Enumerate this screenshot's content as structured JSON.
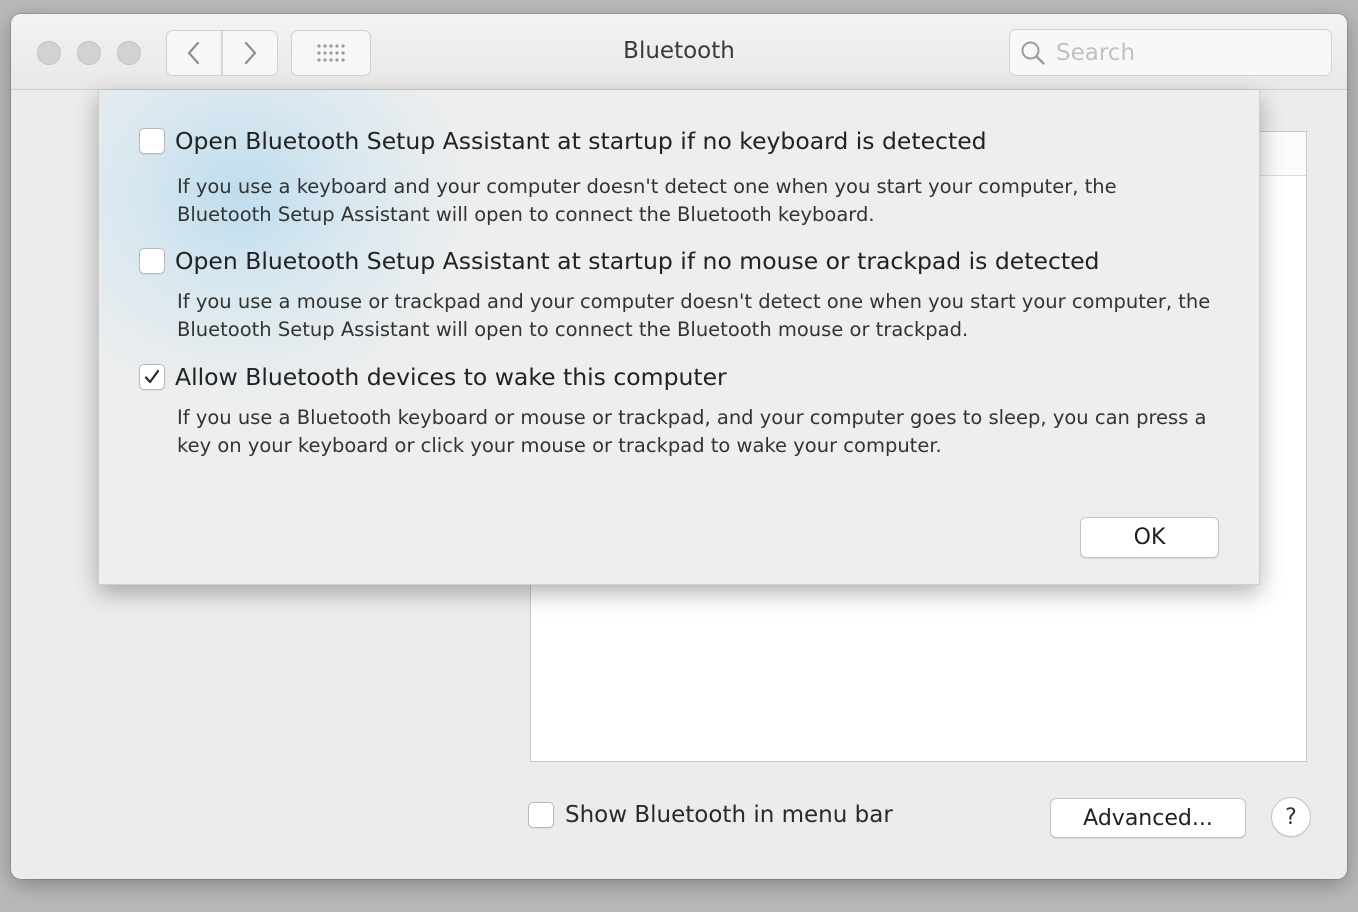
{
  "window": {
    "title": "Bluetooth",
    "search_placeholder": "Search"
  },
  "sheet": {
    "options": [
      {
        "label": "Open Bluetooth Setup Assistant at startup if no keyboard is detected",
        "checked": false,
        "description": "If you use a keyboard and your computer doesn't detect one when you start your computer, the Bluetooth Setup Assistant will open to connect the Bluetooth keyboard."
      },
      {
        "label": "Open Bluetooth Setup Assistant at startup if no mouse or trackpad is detected",
        "checked": false,
        "description": "If you use a mouse or trackpad and your computer doesn't detect one when you start your computer, the Bluetooth Setup Assistant will open to connect the Bluetooth mouse or trackpad."
      },
      {
        "label": "Allow Bluetooth devices to wake this computer",
        "checked": true,
        "description": "If you use a Bluetooth keyboard or mouse or trackpad, and your computer goes to sleep, you can press a key on your keyboard or click your mouse or trackpad to wake your computer."
      }
    ],
    "ok_label": "OK"
  },
  "footer": {
    "show_in_menu_bar_label": "Show Bluetooth in menu bar",
    "show_in_menu_bar_checked": false,
    "advanced_label": "Advanced...",
    "help_label": "?"
  },
  "icons": {
    "back": "chevron-left-icon",
    "forward": "chevron-right-icon",
    "grid": "show-all-grid-icon",
    "search": "search-icon",
    "checkmark": "checkmark-icon"
  }
}
